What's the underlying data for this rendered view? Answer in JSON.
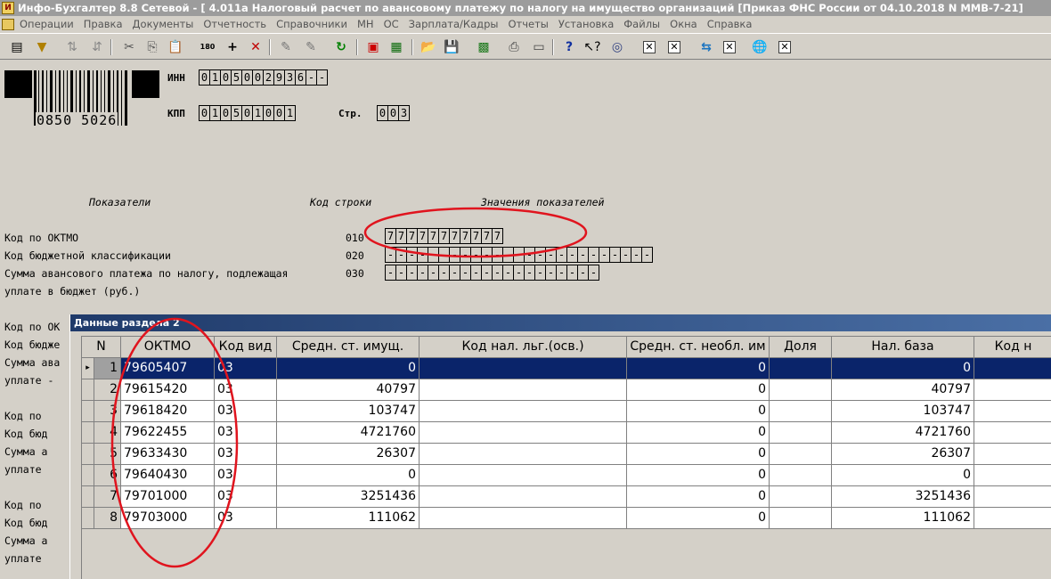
{
  "window": {
    "title": "Инфо-Бухгалтер 8.8 Сетевой - [   4.011а Налоговый расчет по авансовому платежу по налогу на имущество организаций [Приказ ФНС России от 04.10.2018 N ММВ-7-21]"
  },
  "menu": [
    "Операции",
    "Правка",
    "Документы",
    "Отчетность",
    "Справочники",
    "МН",
    "ОС",
    "Зарплата/Кадры",
    "Отчеты",
    "Установка",
    "Файлы",
    "Окна",
    "Справка"
  ],
  "form": {
    "barcode_number": "0850 5026",
    "inn_label": "ИНН",
    "inn_cells": [
      "0",
      "1",
      "0",
      "5",
      "0",
      "0",
      "2",
      "9",
      "3",
      "6",
      "-",
      "-"
    ],
    "kpp_label": "КПП",
    "kpp_cells": [
      "0",
      "1",
      "0",
      "5",
      "0",
      "1",
      "0",
      "0",
      "1"
    ],
    "page_label": "Стр.",
    "page_cells": [
      "0",
      "0",
      "3"
    ],
    "col_indicators": "Показатели",
    "col_code": "Код строки",
    "col_values": "Значения показателей",
    "rows": [
      {
        "label": "Код по ОКТМО",
        "code": "010",
        "cells": [
          "7",
          "7",
          "7",
          "7",
          "7",
          "7",
          "7",
          "7",
          "7",
          "7",
          "7"
        ]
      },
      {
        "label": "Код бюджетной классификации",
        "code": "020",
        "cells": [
          "-",
          "-",
          "-",
          "-",
          "-",
          "-",
          "-",
          "-",
          "-",
          "-",
          "-",
          "-",
          "-",
          "-",
          "-",
          "-",
          "-",
          "-",
          "-",
          "-",
          "-",
          "-",
          "-",
          "-",
          "-"
        ]
      },
      {
        "label": "Сумма авансового платежа по налогу, подлежащая",
        "label2": "уплате в бюджет (руб.)",
        "code": "030",
        "cells": [
          "-",
          "-",
          "-",
          "-",
          "-",
          "-",
          "-",
          "-",
          "-",
          "-",
          "-",
          "-",
          "-",
          "-",
          "-",
          "-",
          "-",
          "-",
          "-",
          "-"
        ]
      }
    ],
    "left_truncated": [
      "Код по ОК",
      "Код бюдже",
      "Сумма ава",
      "уплате -",
      "Код по",
      "Код бюд",
      "Сумма а",
      "уплате",
      "Код по",
      "Код бюд",
      "Сумма а",
      "уплате"
    ]
  },
  "dialog": {
    "title": "Данные раздела 2",
    "columns": [
      "N",
      "ОКТМО",
      "Код вид",
      "Средн. ст. имущ.",
      "Код нал. льг.(осв.)",
      "Средн. ст. необл. им",
      "Доля",
      "Нал. база",
      "Код н"
    ],
    "rows": [
      {
        "n": "1",
        "oktmo": "79605407",
        "kod_vid": "03",
        "sred_st": "0",
        "kod_lg": "",
        "neobl": "0",
        "dolya": "",
        "baza": "0",
        "selected": true
      },
      {
        "n": "2",
        "oktmo": "79615420",
        "kod_vid": "03",
        "sred_st": "40797",
        "kod_lg": "",
        "neobl": "0",
        "dolya": "",
        "baza": "40797"
      },
      {
        "n": "3",
        "oktmo": "79618420",
        "kod_vid": "03",
        "sred_st": "103747",
        "kod_lg": "",
        "neobl": "0",
        "dolya": "",
        "baza": "103747"
      },
      {
        "n": "4",
        "oktmo": "79622455",
        "kod_vid": "03",
        "sred_st": "4721760",
        "kod_lg": "",
        "neobl": "0",
        "dolya": "",
        "baza": "4721760"
      },
      {
        "n": "5",
        "oktmo": "79633430",
        "kod_vid": "03",
        "sred_st": "26307",
        "kod_lg": "",
        "neobl": "0",
        "dolya": "",
        "baza": "26307"
      },
      {
        "n": "6",
        "oktmo": "79640430",
        "kod_vid": "03",
        "sred_st": "0",
        "kod_lg": "",
        "neobl": "0",
        "dolya": "",
        "baza": "0"
      },
      {
        "n": "7",
        "oktmo": "79701000",
        "kod_vid": "03",
        "sred_st": "3251436",
        "kod_lg": "",
        "neobl": "0",
        "dolya": "",
        "baza": "3251436"
      },
      {
        "n": "8",
        "oktmo": "79703000",
        "kod_vid": "03",
        "sred_st": "111062",
        "kod_lg": "",
        "neobl": "0",
        "dolya": "",
        "baza": "111062"
      }
    ]
  },
  "colors": {
    "annotation": "#e0141e",
    "selection": "#0a246a"
  }
}
